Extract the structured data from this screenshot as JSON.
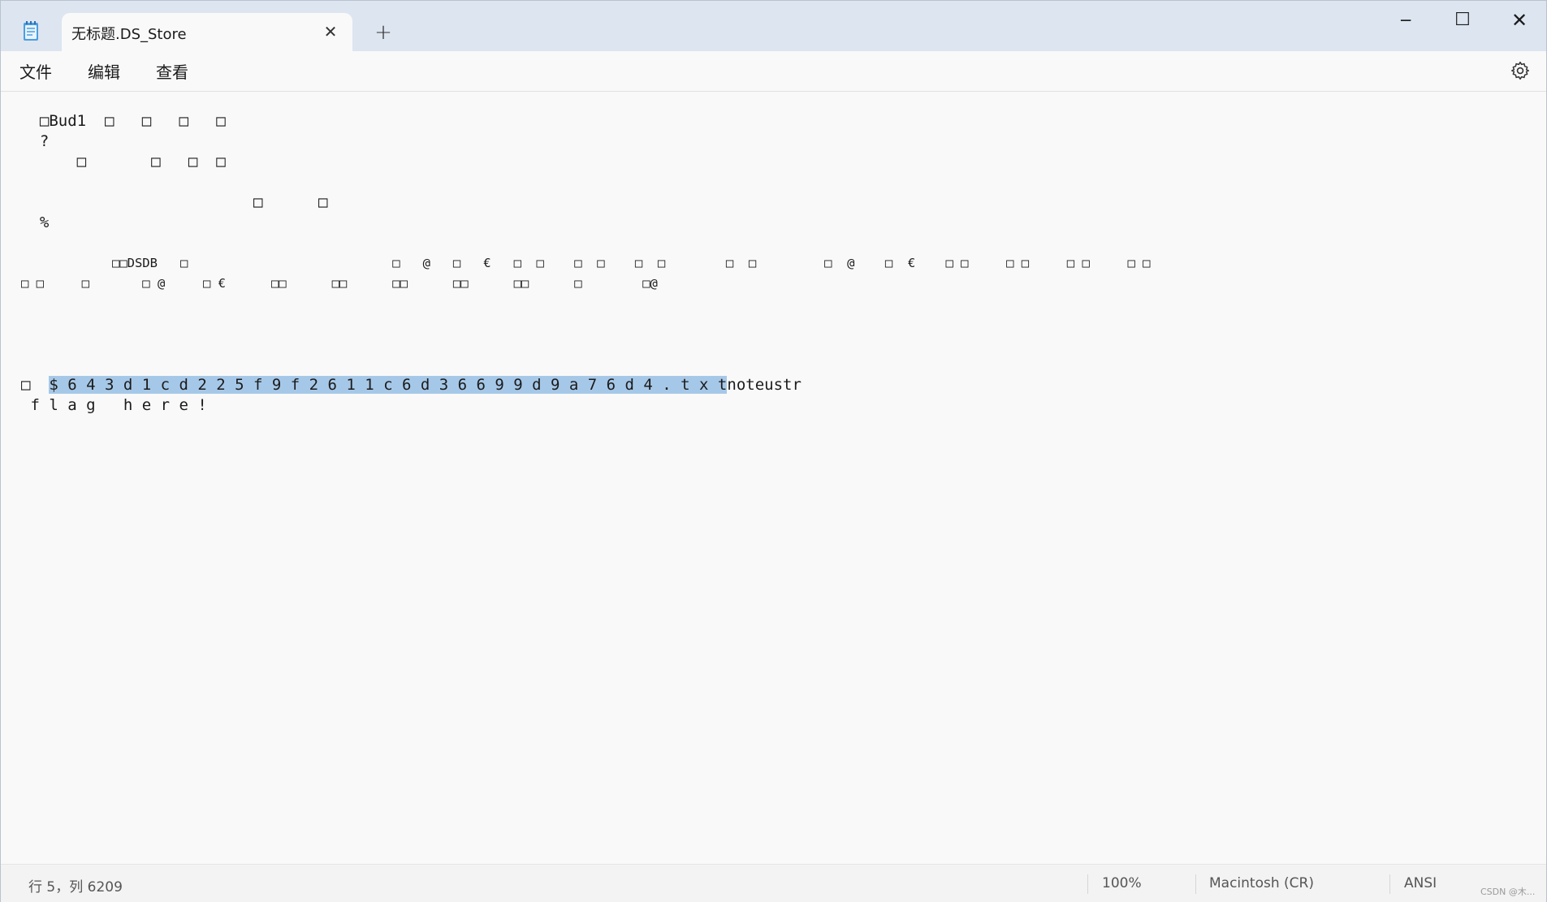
{
  "window": {
    "tab_title": "无标题.DS_Store",
    "tab_close": "✕",
    "new_tab": "+",
    "minimize": "─",
    "maximize": "☐",
    "close": "✕"
  },
  "menu": {
    "file": "文件",
    "edit": "编辑",
    "view": "查看"
  },
  "editor": {
    "lines": [
      "  □Bud1  □   □   □   □",
      "  ?",
      "      □       □   □  □",
      "",
      "                         □      □",
      "  %",
      "",
      "            □□DSDB   □                           □   @   □   €   □  □    □  □    □  □        □  □         □  @    □  €    □ □     □ □     □ □     □ □",
      "□ □     □       □ @     □ €      □□      □□      □□      □□      □□      □        □@",
      "",
      "",
      "",
      "□  "
    ],
    "selected_text": "$ 6 4 3 d 1 c d 2 2 5 f 9 f 2 6 1 1 c 6 d 3 6 6 9 9 d 9 a 7 6 d 4 . t x t",
    "after_selection": "noteustr",
    "flag_line": " f l a g   h e r e !"
  },
  "status": {
    "position": "行 5，列 6209",
    "zoom": "100%",
    "line_ending": "Macintosh (CR)",
    "encoding": "ANSI",
    "watermark": "CSDN @木..."
  },
  "colors": {
    "titlebar": "#dde5f0",
    "selection": "#a6c8e8",
    "background": "#f9f9f9"
  }
}
